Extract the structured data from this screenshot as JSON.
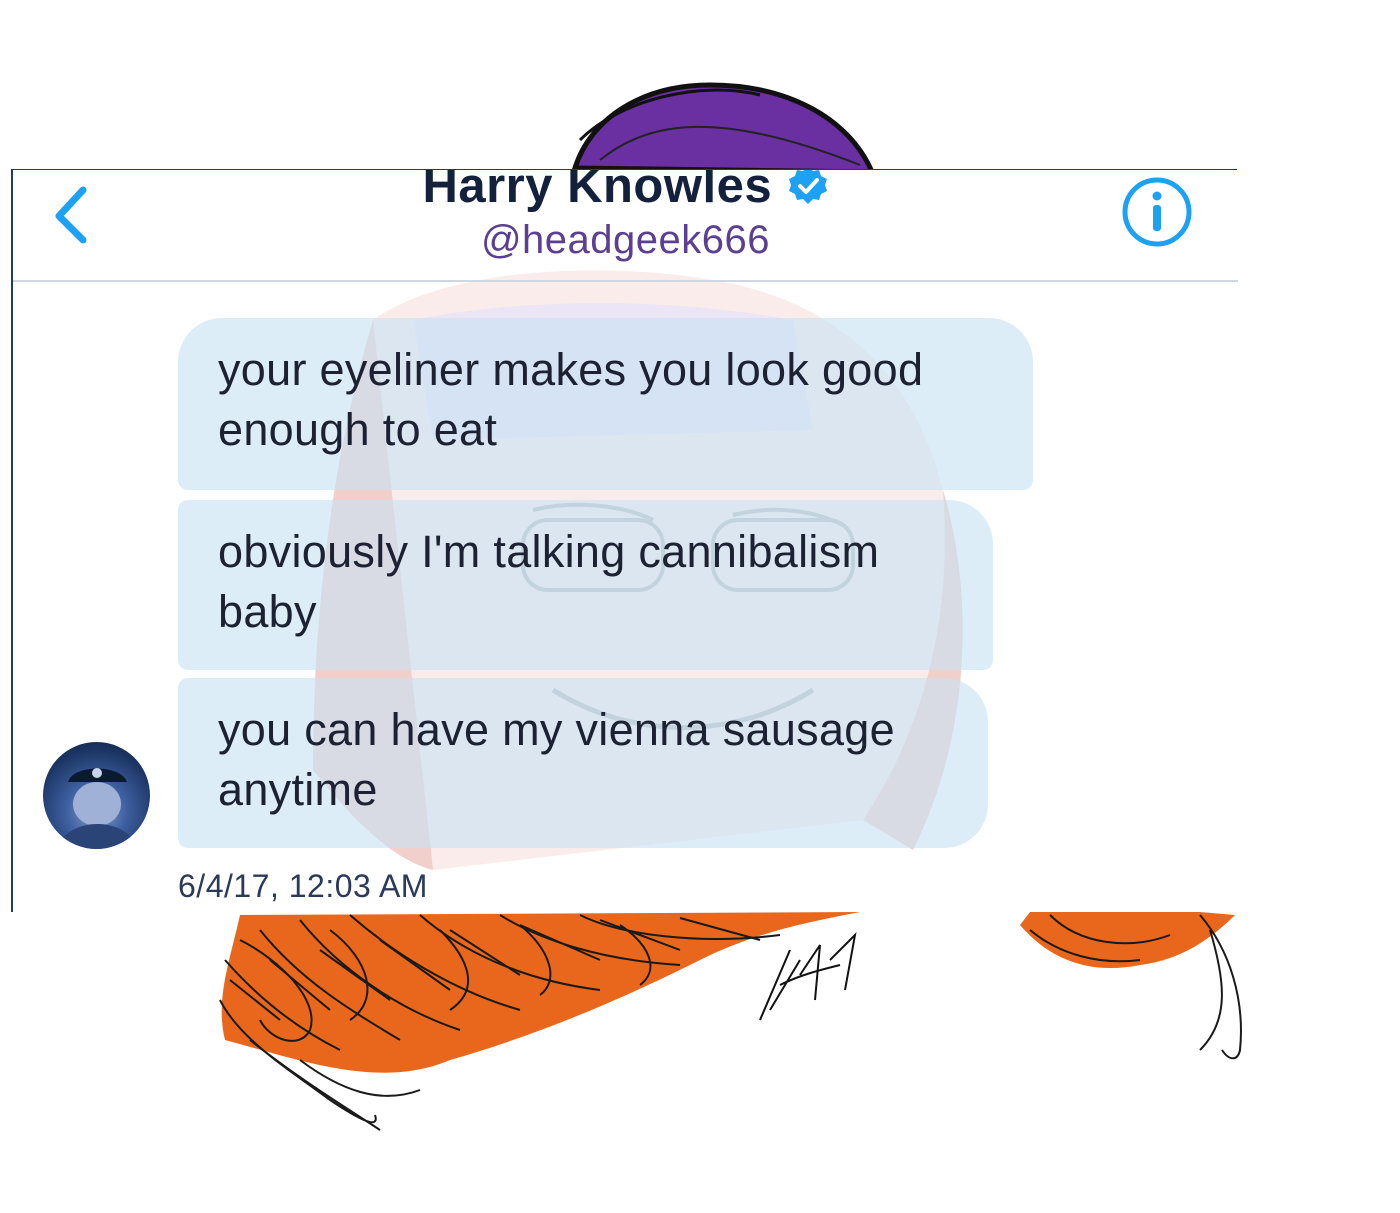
{
  "header": {
    "name": "Harry Knowles",
    "handle": "@headgeek666"
  },
  "messages": [
    {
      "text": "your eyeliner makes you look good enough to eat"
    },
    {
      "text": "obviously I'm talking cannibalism baby"
    },
    {
      "text": "you can have my vienna sausage anytime"
    }
  ],
  "timestamp": "6/4/17, 12:03 AM",
  "icons": {
    "back": "chevron-left-icon",
    "verified": "verified-badge-icon",
    "info": "info-icon"
  },
  "colors": {
    "accent": "#1da1f2",
    "title": "#14213d",
    "handle": "#5b3f92",
    "bubble": "#c8e2f4",
    "hair": "#e8671c",
    "hat": "#6a2fa0"
  }
}
